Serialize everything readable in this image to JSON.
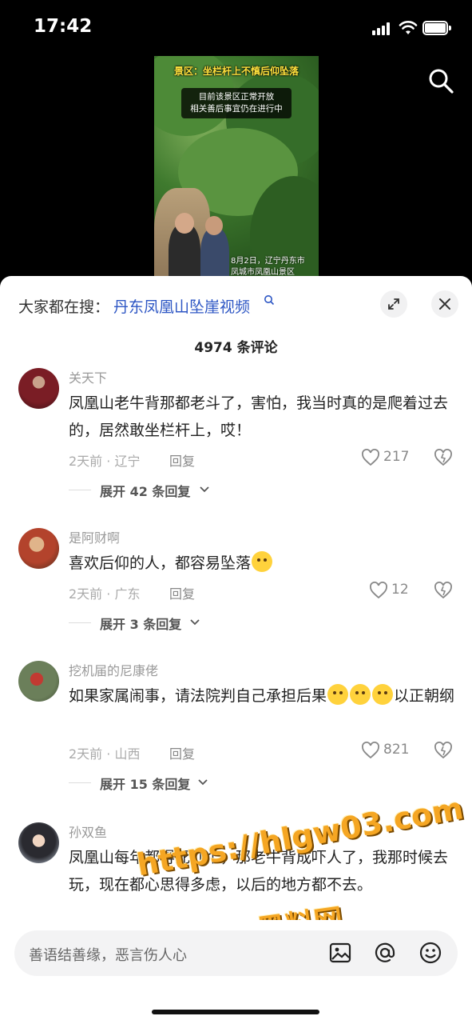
{
  "status_bar": {
    "time": "17:42"
  },
  "video": {
    "caption_top": "景区：坐栏杆上不慎后仰坠落",
    "caption_box_line1": "目前该景区正常开放",
    "caption_box_line2": "相关善后事宜仍在进行中",
    "caption_bottom_line1": "8月2日，辽宁丹东市",
    "caption_bottom_line2": "凤城市凤凰山景区",
    "search_icon": "search-icon"
  },
  "sheet": {
    "hot_search_prefix": "大家都在搜：",
    "hot_search_link": "丹东凤凰山坠崖视频",
    "comment_count": "4974 条评论",
    "expand_icon": "expand-icon",
    "close_icon": "close-icon"
  },
  "comments": [
    {
      "user": "关天下",
      "text": "凤凰山老牛背那都老斗了，害怕，我当时真的是爬着过去的，居然敢坐栏杆上，哎！",
      "meta": "2天前 · 辽宁",
      "reply": "回复",
      "likes": "217",
      "expand": "展开 42 条回复"
    },
    {
      "user": "是阿财啊",
      "text": "喜欢后仰的人，都容易坠落",
      "meta": "2天前 · 广东",
      "reply": "回复",
      "likes": "12",
      "expand": "展开 3 条回复"
    },
    {
      "user": "挖机届的尼康佬",
      "text_part1": "如果家属闹事，请法院判自己承担后果",
      "text_part2": "以正朝纲",
      "meta": "2天前 · 山西",
      "reply": "回复",
      "likes": "821",
      "expand": "展开 15 条回复"
    },
    {
      "user": "孙双鱼",
      "text": "凤凰山每年都得死几个，那老牛背成吓人了，我那时候去玩，现在都心思得多虑，以后的地方都不去。"
    }
  ],
  "watermark": {
    "line1": "https://hlgw03.com",
    "line2": "黑料网"
  },
  "input_bar": {
    "placeholder": "善语结善缘，恶言伤人心",
    "icons": [
      "image-icon",
      "at-icon",
      "emoji-icon"
    ]
  },
  "colors": {
    "link": "#2d56c4",
    "watermark": "#f5a623"
  }
}
